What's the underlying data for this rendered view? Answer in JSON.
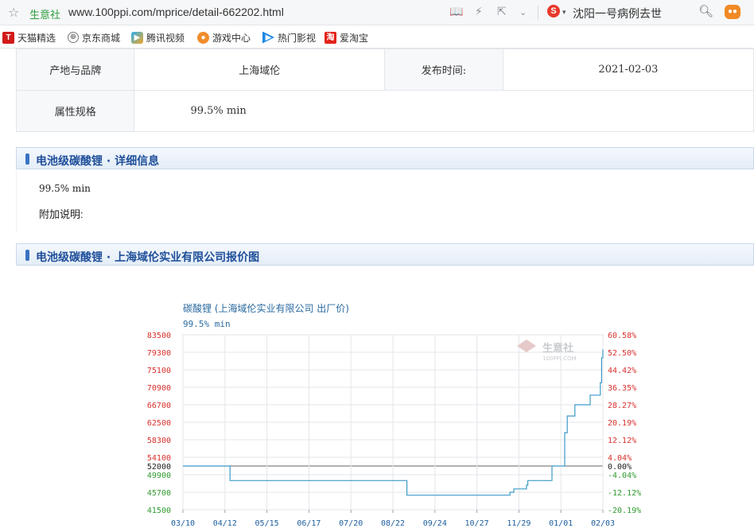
{
  "browser": {
    "site_name": "生意社",
    "url": "www.100ppi.com/mprice/detail-662202.html",
    "search_engine_icon": "S",
    "search_text": "沈阳一号病例去世",
    "icons": [
      "star-icon",
      "reader-icon",
      "bolt-icon",
      "share-icon",
      "chevron-down-icon",
      "search-icon",
      "game-icon"
    ]
  },
  "bookmarks": [
    {
      "label": "天猫精选",
      "icon": "T"
    },
    {
      "label": "京东商城",
      "icon": "⊕"
    },
    {
      "label": "腾讯视频",
      "icon": "▶"
    },
    {
      "label": "游戏中心",
      "icon": "●"
    },
    {
      "label": "热门影视",
      "icon": "▶"
    },
    {
      "label": "爱淘宝",
      "icon": "淘"
    }
  ],
  "info": {
    "origin_label": "产地与品牌",
    "origin_value": "上海域伦",
    "publish_label": "发布时间:",
    "publish_value": "2021-02-03",
    "spec_label": "属性规格",
    "spec_value": "99.5% min"
  },
  "detail_section": {
    "title": "电池级碳酸锂 · 详细信息",
    "spec": "99.5% min",
    "note_label": "附加说明:"
  },
  "chart_section": {
    "title": "电池级碳酸锂 · 上海域伦实业有限公司报价图"
  },
  "chart_data": {
    "type": "line",
    "title": "碳酸锂 (上海域伦实业有限公司 出厂价)",
    "subtitle": "99.5% min",
    "watermark": "生意社",
    "watermark_sub": "100PPI.COM",
    "x_ticks": [
      "03/10",
      "04/12",
      "05/15",
      "06/17",
      "07/20",
      "08/22",
      "09/24",
      "10/27",
      "11/29",
      "01/01",
      "02/03"
    ],
    "y_ticks_left": [
      "83500",
      "79300",
      "75100",
      "70900",
      "66700",
      "62500",
      "58300",
      "54100",
      "52000",
      "49900",
      "45700",
      "41500"
    ],
    "y_ticks_right": [
      "60.58%",
      "52.50%",
      "44.42%",
      "36.35%",
      "28.27%",
      "20.19%",
      "12.12%",
      "4.04%",
      "0.00%",
      "-4.04%",
      "-12.12%",
      "-20.19%"
    ],
    "ylim": [
      41500,
      83500
    ],
    "baseline": 52000,
    "grid": true,
    "series": [
      {
        "x": [
          "03/10",
          "04/15",
          "04/16",
          "08/24",
          "09/01",
          "09/02",
          "11/20",
          "11/22",
          "11/25",
          "12/05",
          "12/06",
          "12/24",
          "12/25",
          "01/02",
          "01/04",
          "01/06",
          "01/10",
          "01/12",
          "01/20",
          "01/24",
          "01/30",
          "02/01",
          "02/02",
          "02/03"
        ],
        "values": [
          52000,
          52000,
          48500,
          48500,
          48500,
          45000,
          45000,
          45700,
          46500,
          47400,
          48500,
          48500,
          52000,
          52000,
          60000,
          64000,
          64000,
          66700,
          66700,
          69000,
          69000,
          72000,
          78000,
          80000
        ]
      }
    ]
  }
}
